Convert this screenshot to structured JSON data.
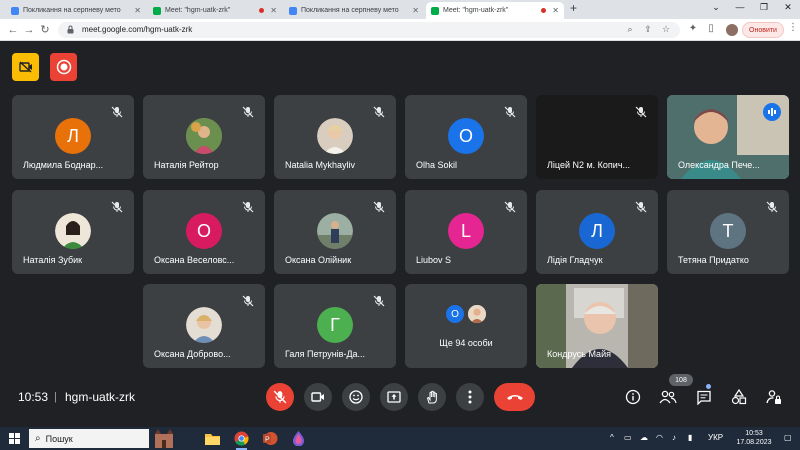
{
  "browser": {
    "tabs": [
      {
        "label": "Покликання на серпневу мето"
      },
      {
        "label": "Meet: \"hgm-uatk-zrk\""
      },
      {
        "label": "Покликання на серпневу мето"
      },
      {
        "label": "Meet: \"hgm-uatk-zrk\""
      }
    ],
    "url": "meet.google.com/hgm-uatk-zrk",
    "update_label": "Оновити"
  },
  "tiles": [
    {
      "name": "Людмила Боднар...",
      "initial": "Л",
      "color": "#e8710a"
    },
    {
      "name": "Наталія Рейтор",
      "initial": "",
      "color": "#8d9e5a"
    },
    {
      "name": "Natalia Mykhayliv",
      "initial": "",
      "color": "#c7a98a"
    },
    {
      "name": "Olha Sokil",
      "initial": "O",
      "color": "#1a73e8"
    },
    {
      "name": "Ліцей N2 м. Копич...",
      "initial": "",
      "color": ""
    },
    {
      "name": "Олександра Пече...",
      "initial": "",
      "color": ""
    },
    {
      "name": "Наталія Зубик",
      "initial": "",
      "color": "#a65a4a"
    },
    {
      "name": "Оксана Веселовс...",
      "initial": "О",
      "color": "#d81b60"
    },
    {
      "name": "Оксана Олійник",
      "initial": "",
      "color": "#7f8c6a"
    },
    {
      "name": "Liubov S",
      "initial": "L",
      "color": "#e52592"
    },
    {
      "name": "Лідія Гладчук",
      "initial": "Л",
      "color": "#1967d2"
    },
    {
      "name": "Тетяна Придатко",
      "initial": "Т",
      "color": "#5f7481"
    },
    {
      "name": "Оксана Доброво...",
      "initial": "",
      "color": "#d4b69a"
    },
    {
      "name": "Галя Петрунів-Да...",
      "initial": "Г",
      "color": "#4caf50"
    },
    {
      "name": "Ще 94 особи",
      "initial": "O",
      "color": "#1a73e8"
    },
    {
      "name": "Кондрусь Майя",
      "initial": "",
      "color": ""
    }
  ],
  "meeting": {
    "time": "10:53",
    "separator": "|",
    "code": "hgm-uatk-zrk",
    "participants_count": "108"
  },
  "taskbar": {
    "search_label": "Пошук",
    "language": "УКР",
    "time": "10:53",
    "date": "17.08.2023"
  },
  "colors": {
    "meet_bg": "#202124",
    "tile_bg": "#3c4043",
    "danger": "#ea4335",
    "accent": "#8ab4f8",
    "yellow_btn": "#fbbc04"
  }
}
